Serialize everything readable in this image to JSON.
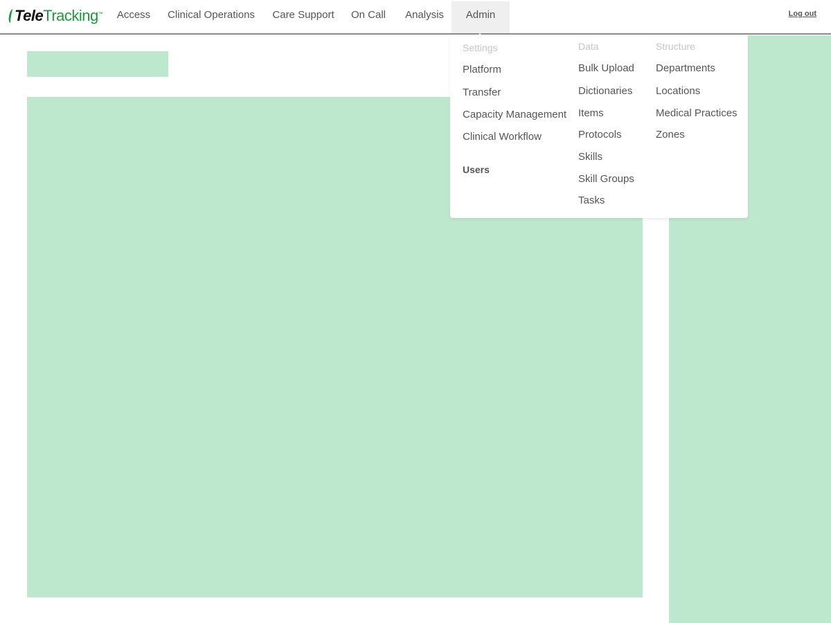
{
  "brand": {
    "logo_tele": "Tele",
    "logo_tracking": "Tracking"
  },
  "nav": {
    "items": [
      {
        "label": "Access"
      },
      {
        "label": "Clinical Operations"
      },
      {
        "label": "Care Support"
      },
      {
        "label": "On Call"
      },
      {
        "label": "Analysis"
      },
      {
        "label": "Admin"
      }
    ],
    "active": "Admin",
    "logout_label": "Log out"
  },
  "admin_menu": {
    "settings": {
      "heading": "Settings",
      "items": [
        "Platform",
        "Transfer",
        "Capacity Management",
        "Clinical Workflow"
      ],
      "users_label": "Users"
    },
    "data": {
      "heading": "Data",
      "items": [
        "Bulk Upload",
        "Dictionaries",
        "Items",
        "Protocols",
        "Skills",
        "Skill Groups",
        "Tasks"
      ]
    },
    "structure": {
      "heading": "Structure",
      "items": [
        "Departments",
        "Locations",
        "Medical Practices",
        "Zones"
      ]
    }
  },
  "colors": {
    "brand_green": "#1a9a3a",
    "placeholder_green": "#bee8ce",
    "nav_text": "#555555",
    "menu_heading": "#c4c4c4",
    "active_tab_bg": "#efefef"
  }
}
